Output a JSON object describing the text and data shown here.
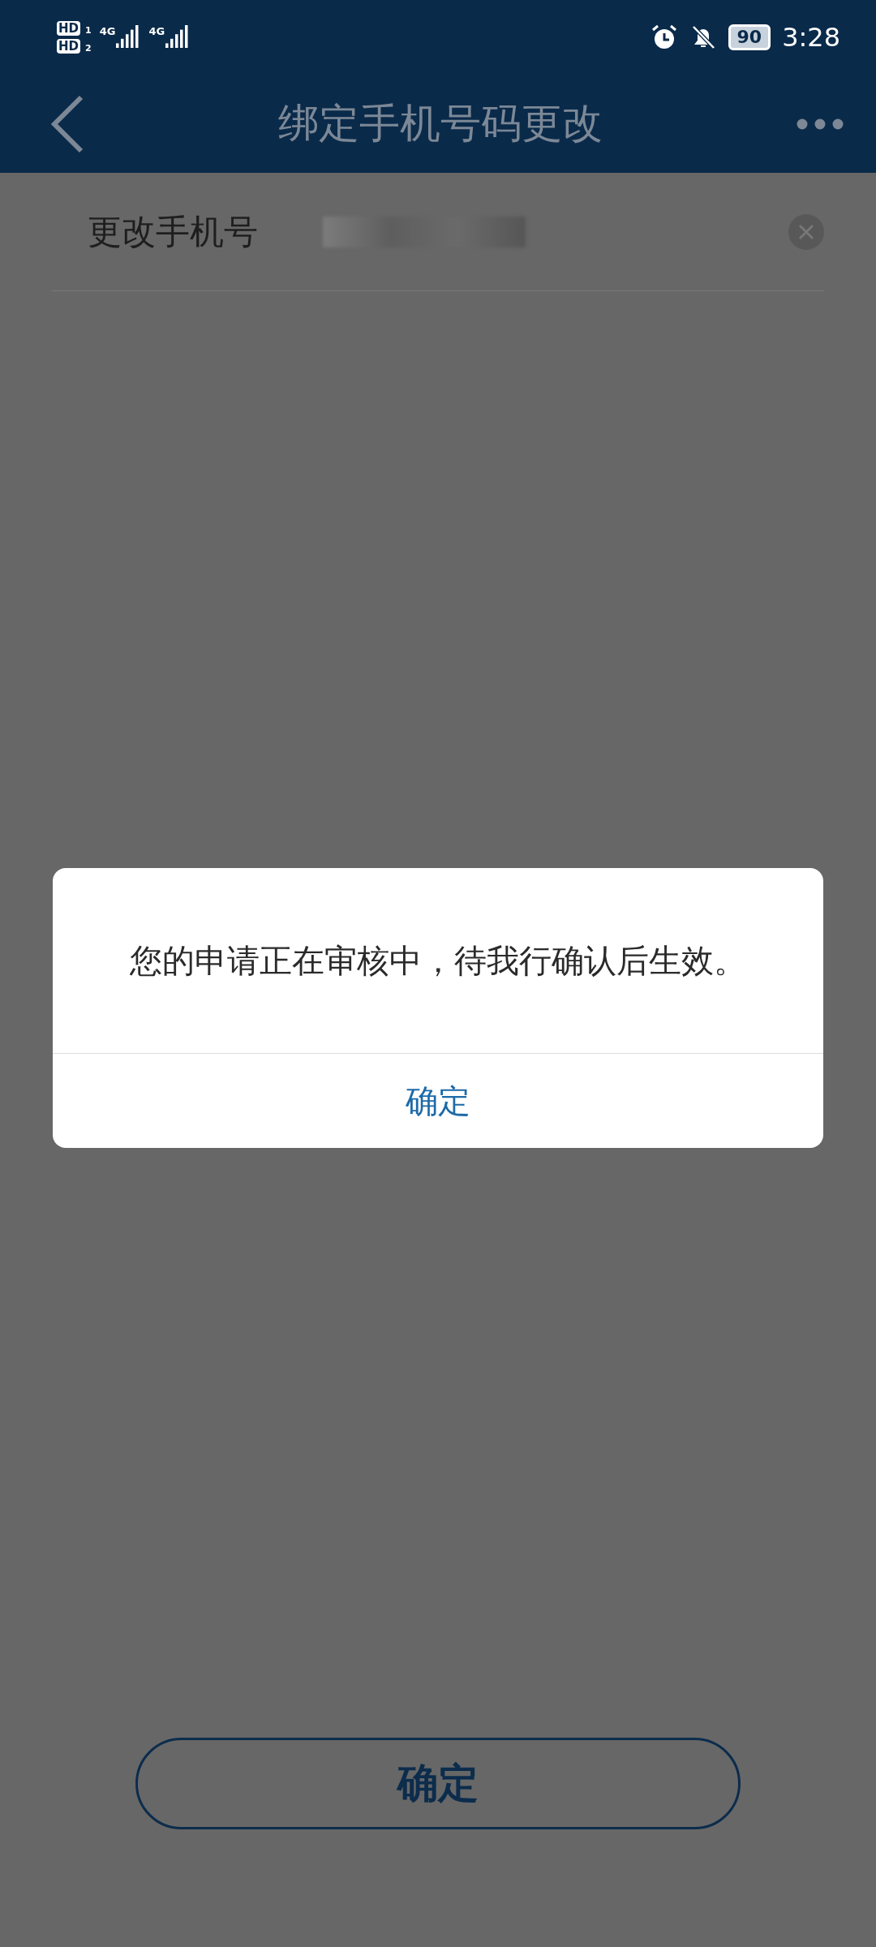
{
  "status_bar": {
    "sims": [
      {
        "badge": "HD",
        "slot": "1",
        "network": "4G"
      },
      {
        "badge": "HD",
        "slot": "2",
        "network": "4G"
      }
    ],
    "battery": "90",
    "time": "3:28"
  },
  "header": {
    "title": "绑定手机号码更改"
  },
  "form": {
    "label": "更改手机号"
  },
  "dialog": {
    "message": "您的申请正在审核中，待我行确认后生效。",
    "button": "确定"
  },
  "submit_button": "确定"
}
